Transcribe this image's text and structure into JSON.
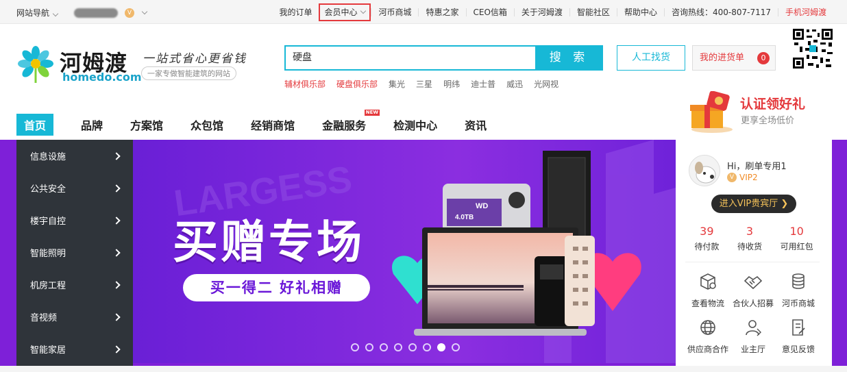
{
  "topbar": {
    "nav_label": "网站导航",
    "user_level_badge": "V",
    "links": [
      "我的订单",
      "会员中心",
      "河币商城",
      "特惠之家",
      "CEO信箱",
      "关于河姆渡",
      "智能社区",
      "帮助中心",
      "咨询热线：400-807-7117",
      "手机河姆渡"
    ]
  },
  "logo": {
    "cn": "河姆渡",
    "en": "homedo.com",
    "slogan": "一站式省心更省钱",
    "slogan_sub": "一家专做智能建筑的网站"
  },
  "search": {
    "value": "硬盘",
    "button": "搜 索",
    "hot": [
      "辅材俱乐部",
      "硬盘俱乐部",
      "集光",
      "三星",
      "明纬",
      "迪士普",
      "威迅",
      "光网视"
    ]
  },
  "actions": {
    "manual": "人工找货",
    "cart": "我的进货单",
    "cart_count": "0"
  },
  "promo": {
    "title": "认证领好礼",
    "subtitle": "更享全场低价"
  },
  "nav": {
    "items": [
      "首页",
      "品牌",
      "方案馆",
      "众包馆",
      "经销商馆",
      "金融服务",
      "检测中心",
      "资讯"
    ],
    "new_badge": "NEW"
  },
  "sidebar": {
    "items": [
      "信息设施",
      "公共安全",
      "楼宇自控",
      "智能照明",
      "机房工程",
      "音视频",
      "智能家居"
    ]
  },
  "banner": {
    "title": "买赠专场",
    "pill": "买一得二  好礼相赠",
    "bg_word": "LARGESS",
    "hdd_label": "4.0TB",
    "hdd_brand": "WD",
    "slide_count": 8,
    "active_slide": 7
  },
  "user": {
    "greeting": "Hi，刷单专用1",
    "level": "VIP2",
    "vip_button": "进入VIP贵宾厅",
    "stats": [
      {
        "num": "39",
        "label": "待付款"
      },
      {
        "num": "3",
        "label": "待收货"
      },
      {
        "num": "10",
        "label": "可用红包"
      }
    ],
    "services": [
      "查看物流",
      "合伙人招募",
      "河币商城",
      "供应商合作",
      "业主厅",
      "意见反馈"
    ]
  },
  "colors": {
    "accent": "#17b8d6",
    "red": "#e4393c",
    "banner_bg": "#7e20d8",
    "sidebar_bg": "#2f343a"
  }
}
